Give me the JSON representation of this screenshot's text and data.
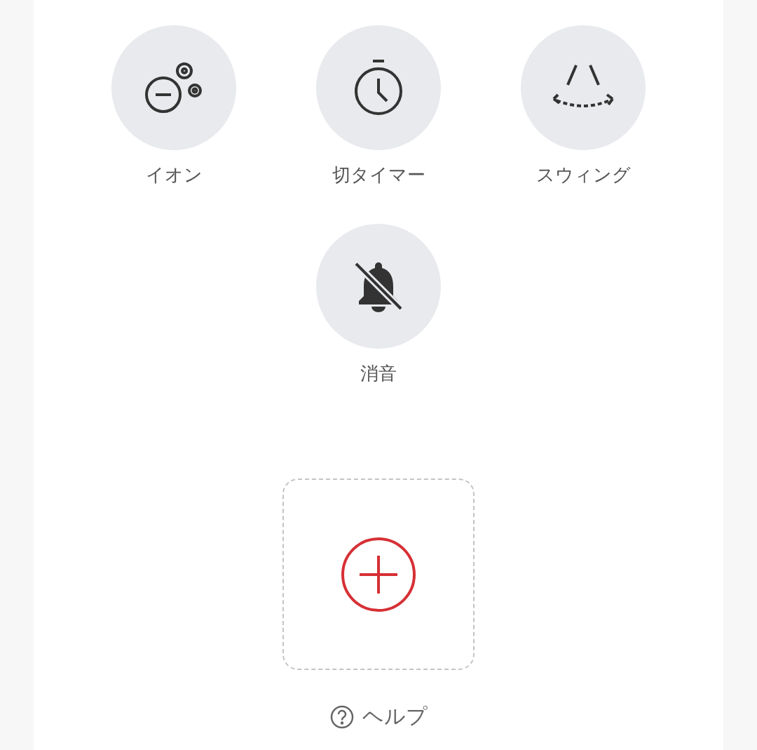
{
  "buttons": [
    {
      "kind": "ion",
      "label": "イオン"
    },
    {
      "kind": "timer",
      "label": "切タイマー"
    },
    {
      "kind": "swing",
      "label": "スウィング"
    },
    {
      "kind": "mute",
      "label": "消音"
    }
  ],
  "help": {
    "label": "ヘルプ"
  }
}
